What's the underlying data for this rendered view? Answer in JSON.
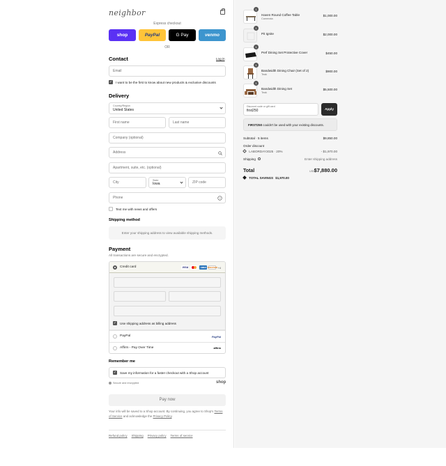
{
  "brand": {
    "logo_text": "neighbor"
  },
  "express": {
    "label": "Express checkout",
    "or": "OR",
    "buttons": {
      "shop": "shop",
      "paypal": "PayPal",
      "gpay": "G Pay",
      "venmo": "venmo"
    }
  },
  "contact": {
    "title": "Contact",
    "login": "Log in",
    "email_placeholder": "Email",
    "news_label": "I want to be the first to know about new products & exclusive discounts"
  },
  "delivery": {
    "title": "Delivery",
    "country_label": "Country/Region",
    "country_value": "United States",
    "first_name": "First name",
    "last_name": "Last name",
    "company": "Company (optional)",
    "address": "Address",
    "apartment": "Apartment, suite, etc. (optional)",
    "city": "City",
    "state_label": "State",
    "state_value": "Iowa",
    "zip": "ZIP code",
    "phone": "Phone",
    "text_label": "Text me with news and offers"
  },
  "shipping": {
    "title": "Shipping method",
    "message": "Enter your shipping address to view available shipping methods."
  },
  "payment": {
    "title": "Payment",
    "subtitle": "All transactions are secure and encrypted.",
    "credit_card": "Credit card",
    "card_logos": [
      "VISA",
      "MC",
      "AMEX",
      "DISCOVER"
    ],
    "more": "+4",
    "billing_label": "Use shipping address as billing address",
    "paypal": "PayPal",
    "paypal_logo": "PayPal",
    "affirm": "Affirm - Pay Over Time",
    "affirm_logo": "affirm"
  },
  "remember": {
    "title": "Remember me",
    "label": "Save my information for a faster checkout with a Shop account",
    "secure": "Secure and encrypted",
    "shop_logo": "shop"
  },
  "pay_now": "Pay now",
  "legal": {
    "text": "Your info will be saved to a Shop account. By continuing, you agree to Shop's",
    "terms": "Terms of Service",
    "and": "and acknowledge the",
    "privacy": "Privacy Policy",
    "end": "."
  },
  "footer": [
    "Refund policy",
    "Shipping",
    "Privacy policy",
    "Terms of service"
  ],
  "cart": {
    "items": [
      {
        "qty": "1",
        "name": "Haven Round Coffee Table",
        "variant": "Camerata",
        "price": "$1,000.00"
      },
      {
        "qty": "1",
        "name": "Pit Ignite",
        "variant": "",
        "price": "$2,000.00"
      },
      {
        "qty": "1",
        "name": "Perf Dining Set Protective Cover",
        "variant": "",
        "price": "$450.00"
      },
      {
        "qty": "1",
        "name": "Bandwidth Dining Chair (Set of 2)",
        "variant": "Teak",
        "price": "$900.00"
      },
      {
        "qty": "1",
        "name": "Bandwidth Dining Set",
        "variant": "Teak",
        "price": "$5,500.00"
      }
    ],
    "discount_label": "Discount code or gift card",
    "discount_value": "first250",
    "apply": "Apply",
    "warning_code": "FIRST250",
    "warning_text": "couldn't be used with your existing discounts.",
    "subtotal_label": "Subtotal · 5 items",
    "subtotal": "$9,850.00",
    "order_discount_label": "Order discount",
    "discount_code": "LABORDAY2025 · 20%",
    "discount_amount": "- $1,970.00",
    "shipping_label": "Shipping",
    "shipping_value": "Enter shipping address",
    "total_label": "Total",
    "currency": "USD",
    "total": "$7,880.00",
    "savings_label": "TOTAL SAVINGS",
    "savings": "$1,970.00"
  },
  "colors": {
    "shop": "#5a31f4",
    "paypal": "#ffc439",
    "gpay": "#000000",
    "venmo": "#3d95ce",
    "apply": "#2b2b2b"
  }
}
